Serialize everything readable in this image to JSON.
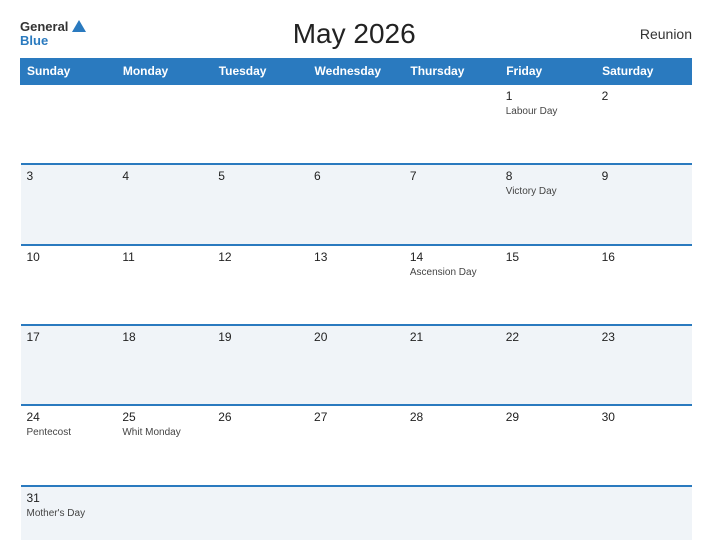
{
  "header": {
    "logo_general": "General",
    "logo_blue": "Blue",
    "title": "May 2026",
    "region": "Reunion"
  },
  "days_of_week": [
    "Sunday",
    "Monday",
    "Tuesday",
    "Wednesday",
    "Thursday",
    "Friday",
    "Saturday"
  ],
  "weeks": [
    [
      {
        "num": "",
        "event": ""
      },
      {
        "num": "",
        "event": ""
      },
      {
        "num": "",
        "event": ""
      },
      {
        "num": "",
        "event": ""
      },
      {
        "num": "",
        "event": ""
      },
      {
        "num": "1",
        "event": "Labour Day"
      },
      {
        "num": "2",
        "event": ""
      }
    ],
    [
      {
        "num": "3",
        "event": ""
      },
      {
        "num": "4",
        "event": ""
      },
      {
        "num": "5",
        "event": ""
      },
      {
        "num": "6",
        "event": ""
      },
      {
        "num": "7",
        "event": ""
      },
      {
        "num": "8",
        "event": "Victory Day"
      },
      {
        "num": "9",
        "event": ""
      }
    ],
    [
      {
        "num": "10",
        "event": ""
      },
      {
        "num": "11",
        "event": ""
      },
      {
        "num": "12",
        "event": ""
      },
      {
        "num": "13",
        "event": ""
      },
      {
        "num": "14",
        "event": "Ascension Day"
      },
      {
        "num": "15",
        "event": ""
      },
      {
        "num": "16",
        "event": ""
      }
    ],
    [
      {
        "num": "17",
        "event": ""
      },
      {
        "num": "18",
        "event": ""
      },
      {
        "num": "19",
        "event": ""
      },
      {
        "num": "20",
        "event": ""
      },
      {
        "num": "21",
        "event": ""
      },
      {
        "num": "22",
        "event": ""
      },
      {
        "num": "23",
        "event": ""
      }
    ],
    [
      {
        "num": "24",
        "event": "Pentecost"
      },
      {
        "num": "25",
        "event": "Whit Monday"
      },
      {
        "num": "26",
        "event": ""
      },
      {
        "num": "27",
        "event": ""
      },
      {
        "num": "28",
        "event": ""
      },
      {
        "num": "29",
        "event": ""
      },
      {
        "num": "30",
        "event": ""
      }
    ],
    [
      {
        "num": "31",
        "event": "Mother's Day"
      },
      {
        "num": "",
        "event": ""
      },
      {
        "num": "",
        "event": ""
      },
      {
        "num": "",
        "event": ""
      },
      {
        "num": "",
        "event": ""
      },
      {
        "num": "",
        "event": ""
      },
      {
        "num": "",
        "event": ""
      }
    ]
  ]
}
